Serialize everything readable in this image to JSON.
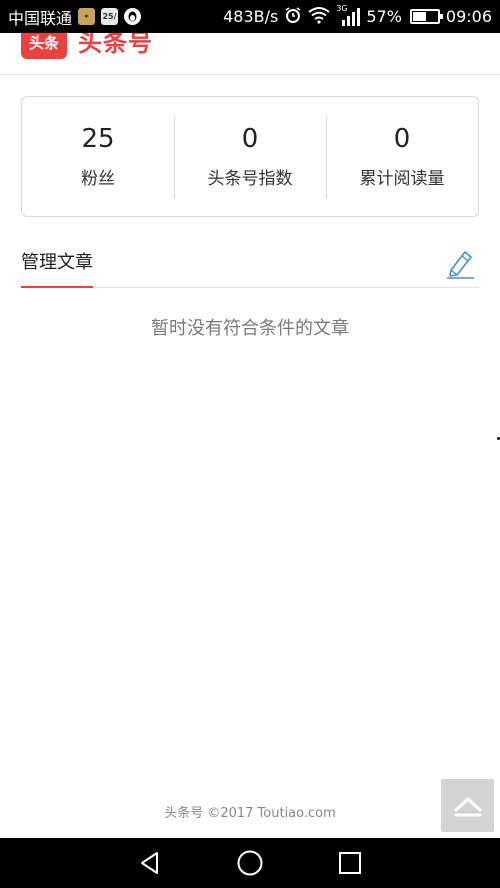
{
  "status_bar": {
    "carrier": "中国联通",
    "speed": "483B/s",
    "network": "3G",
    "battery_percent": "57%",
    "battery_level": 0.57,
    "time": "09:06",
    "app_icon_2_text": "25/",
    "icons": [
      "app-icon",
      "calendar-icon",
      "qq-icon",
      "alarm-icon",
      "wifi-icon",
      "signal-icon",
      "battery-icon"
    ]
  },
  "header": {
    "logo_box_text": "头条",
    "logo_text": "头条号"
  },
  "stats": [
    {
      "value": "25",
      "label": "粉丝"
    },
    {
      "value": "0",
      "label": "头条号指数"
    },
    {
      "value": "0",
      "label": "累计阅读量"
    }
  ],
  "section": {
    "title": "管理文章",
    "edit_icon": "pencil-icon"
  },
  "empty_message": "暂时没有符合条件的文章",
  "footer": {
    "text": "头条号  ©2017 Toutiao.com"
  },
  "back_to_top_icon": "chevron-up-icon",
  "nav_bar": {
    "icons": [
      "back-icon",
      "home-icon",
      "recent-apps-icon"
    ]
  },
  "colors": {
    "brand": "#ed4040",
    "accent_blue": "#4a8fd6",
    "muted_text": "#7a7a7a"
  }
}
